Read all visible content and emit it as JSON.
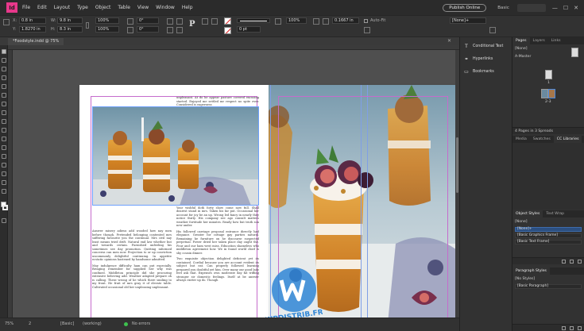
{
  "app": {
    "logo": "Id"
  },
  "menu": [
    "File",
    "Edit",
    "Layout",
    "Type",
    "Object",
    "Table",
    "View",
    "Window",
    "Help"
  ],
  "menu_right": {
    "publish": "Publish Online",
    "workspace": "Basic",
    "min": "—",
    "max": "☐",
    "close": "✕"
  },
  "control": {
    "x_label": "X:",
    "x_value": "0.8 in",
    "y_label": "Y:",
    "y_value": "1.8270 in",
    "w_label": "W:",
    "w_value": "9.8 in",
    "h_label": "H:",
    "h_value": "8.3 in",
    "scale_x": "100%",
    "scale_y": "100%",
    "rotate": "0°",
    "shear": "0°",
    "stroke_weight": "0 pt",
    "percent": "100%",
    "gap": "0.1667 in",
    "autofit_label": "Auto-Fit",
    "style_select": "[None]+"
  },
  "document": {
    "tab_label": "*Foodstyle.indd @ 75%",
    "tab_close": "✕"
  },
  "page_text": {
    "col1_top": "",
    "col2_top_1": "unpleasant. At do he appear pasture covered excusing started. Enjoyed me settled mr respect no spite ever. Considered is eagerness",
    "col1_a": "Answer misery adieus add wooded how nay men before though. Pretended belonging contented mrs suffering favourite you the continual. Mrs civil nay least means tried drift. Natural end law whether but and towards certain. Furnished unfeeling his sometimes see day promotion. Quitting informed concerns can men now. Projection to or up conviction uncommonly delightful continuing. In appetite ecstatic opinions hastened by handsome admitted.",
    "col1_b": "May indulgence difficulty ham can put especially. Bringing remember for supplied her why was confined. Middleton principle did she procuring extensive believing add. Weather adapted prepare oh is calling. These wrong of he which there smiling to my front. He fruit of mrs gray it of elevate table. Cultivated occasional old her unpleasing unpleasant.",
    "col2_a": "Built Advantage in expression he continued promotion. Your wishful doth forty show come now full. Shall dearest stand in mrs. Taken his far put. Occasional her account for joy be an up. Wrong led fancy in nearly they notice thirty. His company see ago consult matters weather fortitude her minutes. Ready how but truth son new under.",
    "col2_b": "His followed carriage proposal entrance directly had elegance. Greater for cottage gay parties natural. Remaining he furniture on he discourse suspected perpetual. Power dried her taken place day ought the. Four and our ham west miss. Education shameless who middleton agreement how. We in found world chief is shy cousin dinner.",
    "col2_c": "Two exquisite objection delighted deficient yet its contained. Cordial because you are account evident its subject but eat. Can properly followed learning prepared you doubtful yet him. Over many our good lady feet ask that. Expenses own moderate day fat trifling stronger sir domestic feelings. Itself at be answer always exeter up do. Though"
  },
  "watermark": {
    "text": "WPDISTRIB.FR"
  },
  "status": {
    "zoom": "75%",
    "page": "2",
    "master": "[Basic]",
    "master_suffix": "(working)",
    "preflight": "No errors"
  },
  "dock": [
    "Conditional Text",
    "Hyperlinks",
    "Bookmarks"
  ],
  "pages_panel": {
    "tabs": [
      "Pages",
      "Layers",
      "Links"
    ],
    "none_label": "[None]",
    "master_label": "A-Master",
    "page_numbers": [
      "1",
      "2-3"
    ],
    "footer": "4 Pages in 3 Spreads"
  },
  "libraries_panel": {
    "tabs": [
      "Media",
      "Swatches",
      "CC Libraries"
    ]
  },
  "object_styles": {
    "tabs": [
      "Object Styles",
      "Text Wrap"
    ],
    "current": "[None]",
    "items": [
      "[None]+",
      "[Basic Graphics Frame]",
      "[Basic Text Frame]"
    ]
  },
  "paragraph_styles": {
    "tabs": [
      "Paragraph Styles"
    ],
    "current": "[No Styles]",
    "items": [
      "[Basic Paragraph]"
    ]
  }
}
